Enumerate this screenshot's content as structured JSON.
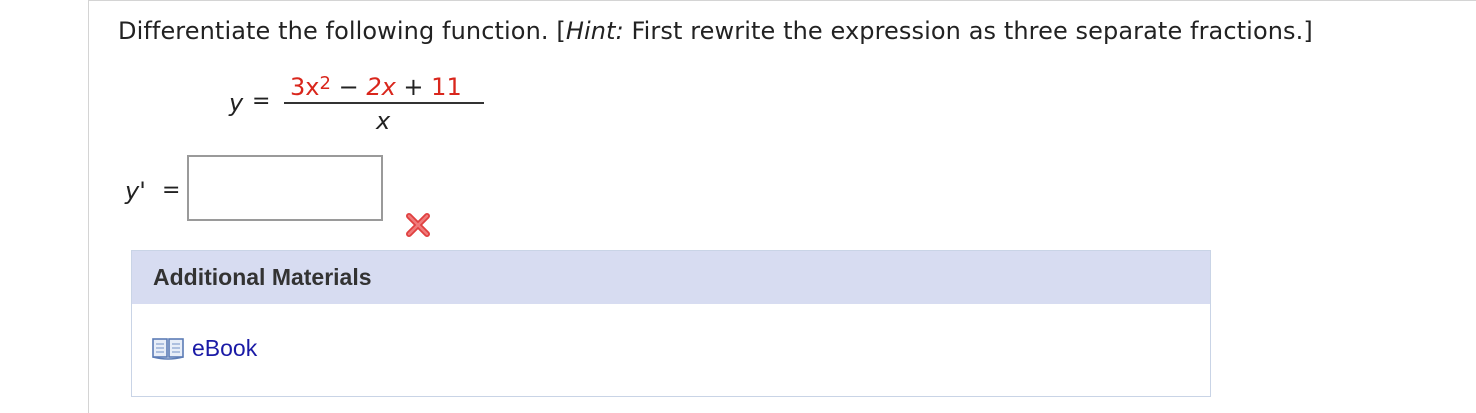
{
  "question": {
    "prefix": "Differentiate the following function. [",
    "hint_label": "Hint:",
    "hint_text": " First rewrite the expression as three separate fractions.]"
  },
  "equation": {
    "lhs": "y",
    "equals": "=",
    "num_a": "3x",
    "num_a_exp": "2",
    "minus": " − ",
    "num_b": "2x",
    "plus": " + ",
    "num_c": "11",
    "denominator": "x"
  },
  "answer": {
    "label": "y'",
    "equals": "=",
    "value": "",
    "status": "incorrect"
  },
  "materials": {
    "header": "Additional Materials",
    "ebook_label": "eBook"
  },
  "colors": {
    "highlight_red": "#d9261c",
    "link_blue": "#1a1aa6",
    "header_bg": "#d7dcf1"
  }
}
